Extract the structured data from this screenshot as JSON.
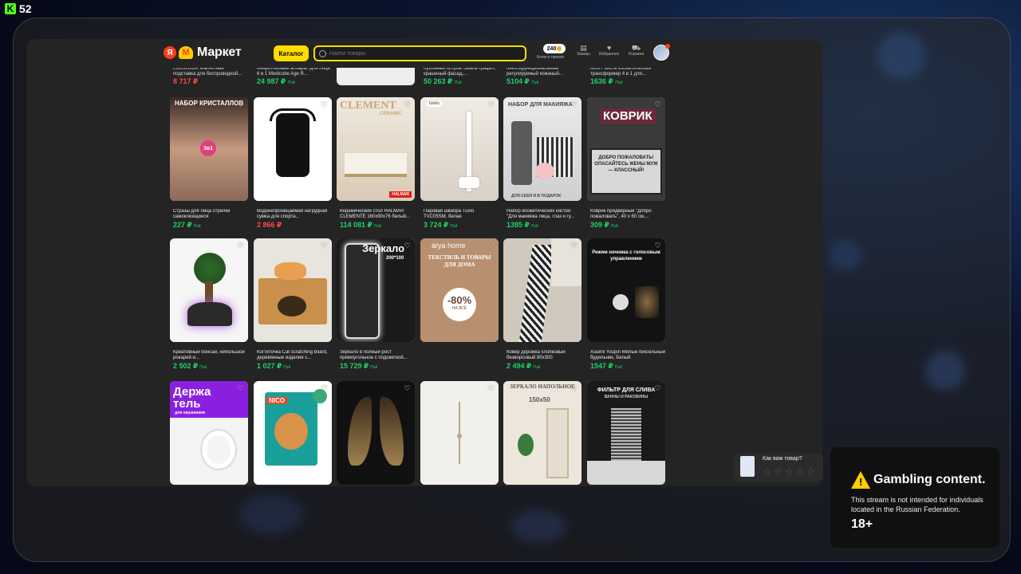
{
  "stream": {
    "viewer_count": "52",
    "platform_icon": "kick-icon"
  },
  "header": {
    "logo_ya": "Я",
    "logo_m": "M",
    "logo_text": "Маркет",
    "catalog_label": "Каталог",
    "search_placeholder": "Найти товары",
    "coins_value": "240",
    "coins_label": "Колесо призов",
    "orders_label": "Заказы",
    "favorites_label": "Избранное",
    "cart_label": "Корзина"
  },
  "partial_row": [
    {
      "title": "LULULOOK Магнитная подставка для беспроводной...",
      "price": "8 717 ₽",
      "price_color": "red"
    },
    {
      "title": "Микротоковый аппарат для лица 6 в 1 Medicube Age R...",
      "price": "24 987 ₽",
      "pay": "Пэй",
      "price_color": "green"
    },
    {
      "title": "",
      "price": "",
      "price_color": "green"
    },
    {
      "title": "Кухонный остров Эмаль графит, крашеный фасад,...",
      "price": "50 263 ₽",
      "pay": "Пэй",
      "price_color": "green"
    },
    {
      "title": "Многофункциональный регулируемый кожаный...",
      "price": "5104 ₽",
      "pay": "Пэй",
      "price_color": "green"
    },
    {
      "title": "MIXIT Кисть косметическая трансформер 4 в 1 для...",
      "price": "1636 ₽",
      "pay": "Пэй",
      "price_color": "green"
    }
  ],
  "row1": [
    {
      "title": "Стразы для лица стрелки самоклеящиеся",
      "price": "227 ₽",
      "pay": "Пэй",
      "price_color": "green",
      "img_text": "НАБОР КРИСТАЛЛОВ",
      "img_badge": "3в1"
    },
    {
      "title": "Водонепроницаемая нагрудная сумка для спорта...",
      "price": "2 866 ₽",
      "pay": "",
      "price_color": "red"
    },
    {
      "title": "Керамический стол HALMAR CLEMENTE 160x90x76 белый...",
      "price": "114 081 ₽",
      "pay": "Пэй",
      "price_color": "green",
      "img_text": "CLEMENT",
      "img_sub": "CERAMIC",
      "img_brand": "HALMAR"
    },
    {
      "title": "Паровая швабра Tuvio TVC05SM, белая",
      "price": "3 724 ₽",
      "pay": "Пэй",
      "price_color": "green",
      "img_brand": "tuvio"
    },
    {
      "title": "Набор косметических кистей \"Для макияжа лица, глаз и гу...",
      "price": "1385 ₽",
      "pay": "Пэй",
      "price_color": "green",
      "img_text": "НАБОР ДЛЯ МАКИЯЖА",
      "img_sub": "ДЛЯ СЕБЯ И В ПОДАРОК"
    },
    {
      "title": "Коврик придверный \"Добро пожаловать\", 40 x 60 см,...",
      "price": "309 ₽",
      "pay": "Пэй",
      "price_color": "green",
      "img_text": "КОВРИК",
      "img_sub": "ДОБРО ПОЖАЛОВАТЬ! ОПАСАЙТЕСЬ ЖЕНЫ МУЖ — КЛАССНЫЙ!"
    }
  ],
  "row2": [
    {
      "title": "Креативный бонсай, небольшой рокарий и...",
      "price": "2 502 ₽",
      "pay": "Пэй",
      "price_color": "green"
    },
    {
      "title": "Когтеточка Cat scratching board, деревянные изделия с...",
      "price": "1 027 ₽",
      "pay": "Пэй",
      "price_color": "green"
    },
    {
      "title": "Зеркало в полный рост прямоугольное с подсветкой...",
      "price": "15 729 ₽",
      "pay": "Пэй",
      "price_color": "green",
      "img_text": "Зеркало",
      "img_sub": "200*100"
    },
    {
      "title": "",
      "price": "",
      "pay": "",
      "price_color": "green",
      "img_brand": "arya home",
      "img_text": "ТЕКСТИЛЬ И ТОВАРЫ ДЛЯ ДОМА",
      "img_badge": "-80%",
      "img_sub": "НА ВСЁ"
    },
    {
      "title": "Ковер дорожка хлопковый безворсовый 80x300",
      "price": "2 494 ₽",
      "pay": "Пэй",
      "price_color": "green"
    },
    {
      "title": "Xiaomi Youpin Милый пиксельный будильник, Белый",
      "price": "1547 ₽",
      "pay": "Пэй",
      "price_color": "green",
      "img_text": "Режим ночника с голосовым управлением"
    }
  ],
  "row3": [
    {
      "img_text": "Держа тель",
      "img_sub": "для наушников"
    },
    {
      "img_brand": "NICO"
    },
    {},
    {},
    {
      "img_text": "ЗЕРКАЛО НАПОЛЬНОЕ",
      "img_sub": "150x50"
    },
    {
      "img_text": "ФИЛЬТР ДЛЯ СЛИВА",
      "img_sub": "ВАННЫ И РАКОВИНЫ"
    }
  ],
  "feedback": {
    "question": "Как вам товар?",
    "stars": [
      "☆",
      "☆",
      "☆",
      "☆",
      "☆"
    ]
  },
  "gambling": {
    "title": "Gambling content.",
    "text": "This stream is not intended for individuals located in the Russian Federation.",
    "age": "18+"
  },
  "colors": {
    "accent_yellow": "#ffdd00",
    "price_green": "#1fd26a",
    "price_red": "#ff4a4a",
    "brand_red": "#fc3f1d"
  }
}
